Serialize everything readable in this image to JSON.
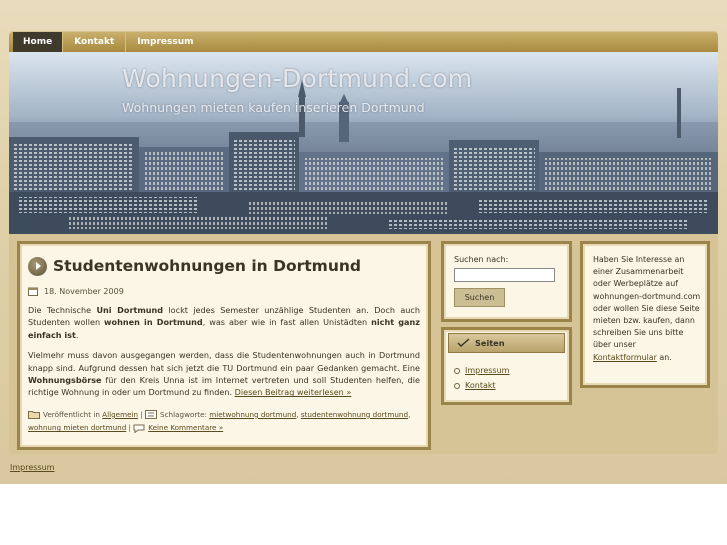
{
  "nav": {
    "items": [
      {
        "label": "Home",
        "active": true
      },
      {
        "label": "Kontakt",
        "active": false
      },
      {
        "label": "Impressum",
        "active": false
      }
    ]
  },
  "header": {
    "title": "Wohnungen-Dortmund.com",
    "subtitle": "Wohnungen mieten kaufen inserieren Dortmund"
  },
  "post": {
    "title": "Studentenwohnungen in Dortmund",
    "date": "18. November 2009",
    "p1": {
      "t1": "Die Technische ",
      "b1": "Uni Dortmund",
      "t2": " lockt jedes Semester unzählige Studenten an. Doch auch Studenten wollen ",
      "b2": "wohnen in Dortmund",
      "t3": ", was aber wie in fast allen Unistädten ",
      "b3": "nicht ganz einfach ist",
      "t4": "."
    },
    "p2": {
      "t1": "Vielmehr muss davon ausgegangen werden, dass die Studentenwohnungen auch in Dortmund knapp sind. Aufgrund dessen hat sich jetzt die TU Dortmund ein paar Gedanken gemacht. Eine ",
      "b1": "Wohnungsbörse",
      "t2": " für den Kreis Unna ist im Internet vertreten und soll Studenten helfen, die richtige Wohnung in oder um Dortmund zu finden. ",
      "more": "Diesen Beitrag weiterlesen »"
    },
    "meta": {
      "published_prefix": "Veröffentlicht in ",
      "category": "Allgemein",
      "sep": " | ",
      "tags_prefix": "Schlagworte: ",
      "tag1": "mietwohnung dortmund",
      "comma": ", ",
      "tag2": "studentenwohnung dortmund",
      "tag3": "wohnung mieten dortmund",
      "comments": "Keine Kommentare »"
    }
  },
  "search": {
    "label": "Suchen nach:",
    "value": "",
    "button": "Suchen"
  },
  "pages": {
    "title": "Seiten",
    "items": [
      "Impressum",
      "Kontakt"
    ]
  },
  "ad": {
    "text": "Haben Sie Interesse an einer Zusammenarbeit oder Werbeplätze auf wohnungen-dortmund.com oder wollen Sie diese Seite mieten bzw. kaufen, dann schreiben Sie uns bitte über unser ",
    "link": "Kontaktformular",
    "suffix": " an."
  },
  "footer": {
    "link": "Impressum"
  },
  "colors": {
    "background": "#e0d1aa",
    "nav": "#a8893f",
    "active_tab": "#3f3a2c",
    "box_border": "#9a844a",
    "box_bg": "#fbf6e5",
    "link": "#5a4a1e"
  }
}
